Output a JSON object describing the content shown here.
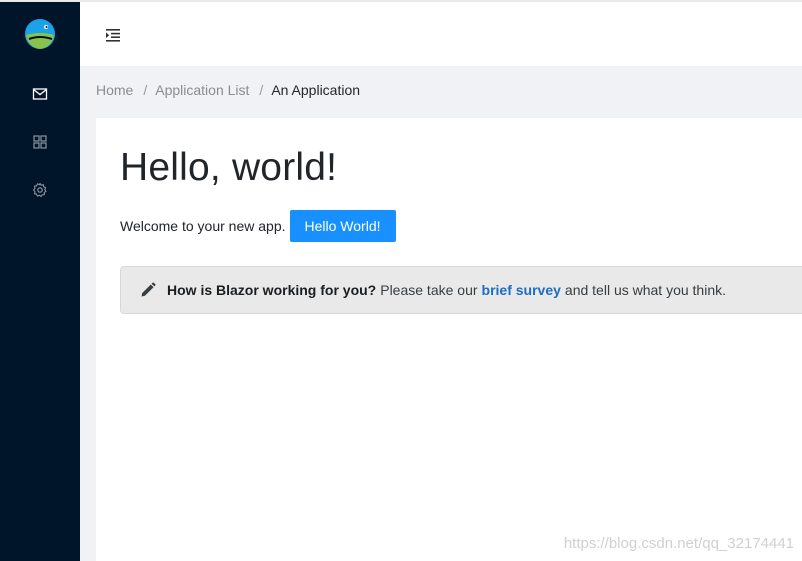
{
  "sidebar": {
    "logo_icon": "fish-logo-icon",
    "items": [
      {
        "icon": "mail-icon"
      },
      {
        "icon": "appstore-icon"
      },
      {
        "icon": "gear-icon"
      }
    ],
    "background": "#001529"
  },
  "header": {
    "menu_toggle_icon": "menu-fold-icon"
  },
  "breadcrumb": {
    "items": [
      "Home",
      "Application List",
      "An Application"
    ],
    "separator": "/"
  },
  "main": {
    "title": "Hello, world!",
    "welcome_text": "Welcome to your new app.",
    "hello_button_label": "Hello World!",
    "alert": {
      "icon": "pencil-icon",
      "bold": "How is Blazor working for you?",
      "before_link": "Please take our",
      "link_text": "brief survey",
      "after_link": "and tell us what you think."
    }
  },
  "watermark": "https://blog.csdn.net/qq_32174441",
  "colors": {
    "accent": "#1890ff",
    "link": "#1b6ec2",
    "content_bg": "#f0f2f5"
  }
}
